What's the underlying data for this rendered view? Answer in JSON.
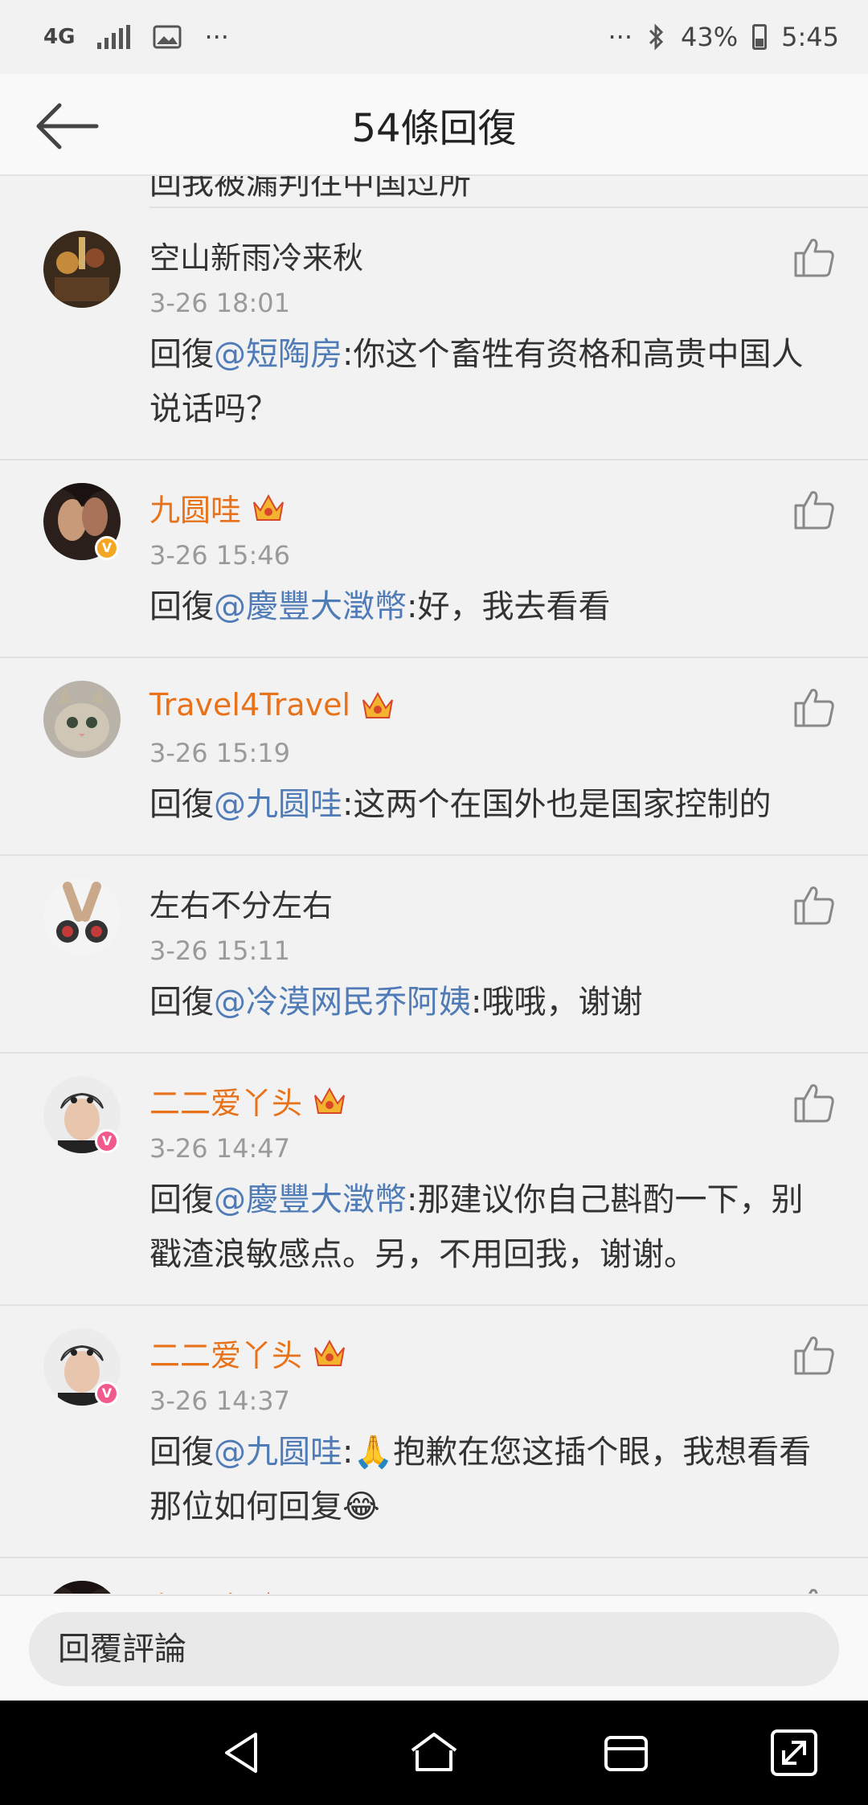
{
  "status_bar": {
    "network": "4G",
    "more": "···",
    "more_right": "···",
    "battery": "43%",
    "time": "5:45"
  },
  "header": {
    "title": "54條回復"
  },
  "partial_text": "回我被漏判往中国过所",
  "colors": {
    "mention": "#4f7bb6",
    "vip_name": "#e8721a",
    "time": "#9a9a9a"
  },
  "comments": [
    {
      "name": "空山新雨冷来秋",
      "vip": false,
      "time": "3-26 18:01",
      "prefix": "回復",
      "mention": "@短陶房",
      "text": ":你这个畜牲有资格和高贵中国人说话吗？"
    },
    {
      "name": "九圆哇",
      "vip": true,
      "time": "3-26 15:46",
      "prefix": "回復",
      "mention": "@慶豐大澂幣",
      "text": ":好，我去看看"
    },
    {
      "name": "Travel4Travel",
      "vip": true,
      "time": "3-26 15:19",
      "prefix": "回復",
      "mention": "@九圆哇",
      "text": ":这两个在国外也是国家控制的"
    },
    {
      "name": "左右不分左右",
      "vip": false,
      "time": "3-26 15:11",
      "prefix": "回復",
      "mention": "@冷漠网民乔阿姨",
      "text": ":哦哦，谢谢"
    },
    {
      "name": "二二爱丫头",
      "vip": true,
      "time": "3-26 14:47",
      "prefix": "回復",
      "mention": "@慶豐大澂幣",
      "text": ":那建议你自己斟酌一下，别戳渣浪敏感点。另，不用回我，谢谢。"
    },
    {
      "name": "二二爱丫头",
      "vip": true,
      "time": "3-26 14:37",
      "prefix": "回復",
      "mention": "@九圆哇",
      "text": ":🙏抱歉在您这插个眼，我想看看那位如何回复😂"
    },
    {
      "name": "九圆哇",
      "vip": true,
      "time": "",
      "prefix": "",
      "mention": "",
      "text": ""
    }
  ],
  "composer": {
    "placeholder": "回覆評論"
  }
}
